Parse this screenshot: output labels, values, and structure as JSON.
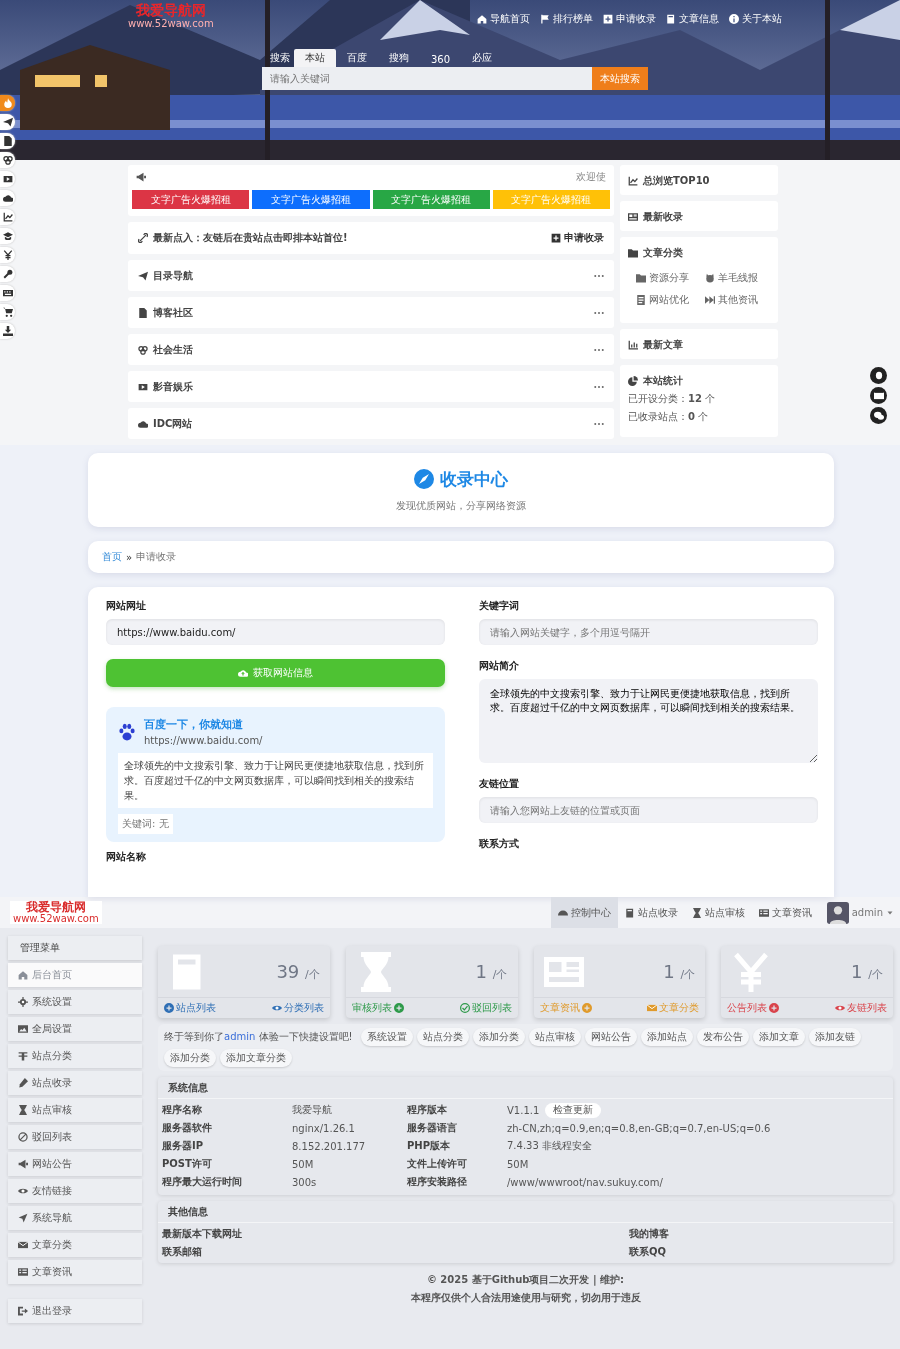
{
  "site": {
    "logo": "我爱导航网",
    "logo_url": "www.52waw.com",
    "nav": [
      "导航首页",
      "排行榜单",
      "申请收录",
      "文章信息",
      "关于本站"
    ],
    "search": {
      "label": "搜索",
      "tabs": [
        {
          "label": "本站",
          "selected": true
        },
        {
          "label": "百度",
          "selected": false
        },
        {
          "label": "搜狗",
          "selected": false
        },
        {
          "label": "360",
          "selected": false
        },
        {
          "label": "必应",
          "selected": false
        }
      ],
      "placeholder": "请输入关键词",
      "button": "本站搜索"
    },
    "notice": {
      "welcome": "欢迎使",
      "ads": [
        {
          "label": "文字广告火爆招租",
          "color": "#dc3545"
        },
        {
          "label": "文字广告火爆招租",
          "color": "#0d6efd"
        },
        {
          "label": "文字广告火爆招租",
          "color": "#28a745"
        },
        {
          "label": "文字广告火爆招租",
          "color": "#ffc107"
        }
      ],
      "tip": "最新点入：友链后在贵站点击即排本站首位!",
      "apply": "申请收录"
    },
    "categories": [
      "目录导航",
      "博客社区",
      "社会生活",
      "影音娱乐",
      "IDC网站"
    ],
    "widgets": {
      "top": "总浏览TOP10",
      "latest": "最新收录",
      "article_categories": {
        "title": "文章分类",
        "items": [
          "资源分享",
          "羊毛线报",
          "网站优化",
          "其他资讯"
        ]
      },
      "latest_articles": "最新文章",
      "stats": {
        "title": "本站统计",
        "rows": [
          {
            "label": "已开设分类：",
            "value": "12",
            "unit": "个"
          },
          {
            "label": "已收录站点：",
            "value": "0",
            "unit": "个"
          }
        ]
      }
    }
  },
  "submit_page": {
    "title": "收录中心",
    "subtitle": "发现优质网站，分享网络资源",
    "breadcrumb": {
      "home": "首页",
      "separator": "»",
      "current": "申请收录"
    },
    "url": {
      "label": "网站网址",
      "value": "https://www.baidu.com/"
    },
    "fetch_button": "获取网站信息",
    "preview": {
      "title": "百度一下，你就知道",
      "url": "https://www.baidu.com/",
      "description": "全球领先的中文搜索引擎、致力于让网民更便捷地获取信息，找到所求。百度超过千亿的中文网页数据库，可以瞬间找到相关的搜索结果。",
      "keywords": "关键词: 无"
    },
    "name_label": "网站名称",
    "keywords": {
      "label": "关键字词",
      "placeholder": "请输入网站关键字，多个用逗号隔开"
    },
    "intro": {
      "label": "网站简介",
      "value": "全球领先的中文搜索引擎、致力于让网民更便捷地获取信息，找到所求。百度超过千亿的中文网页数据库，可以瞬间找到相关的搜索结果。"
    },
    "link_position": {
      "label": "友链位置",
      "placeholder": "请输入您网站上友链的位置或页面"
    },
    "contact_label": "联系方式"
  },
  "admin": {
    "logo": "我爱导航网",
    "logo_url": "www.52waw.com",
    "nav": [
      {
        "label": "控制中心",
        "selected": true
      },
      {
        "label": "站点收录",
        "selected": false
      },
      {
        "label": "站点审核",
        "selected": false
      },
      {
        "label": "文章资讯",
        "selected": false
      }
    ],
    "user": "admin",
    "menu_title": "管理菜单",
    "menu": [
      {
        "label": "后台首页",
        "selected": true
      },
      {
        "label": "系统设置",
        "selected": false
      },
      {
        "label": "全局设置",
        "selected": false
      },
      {
        "label": "站点分类",
        "selected": false
      },
      {
        "label": "站点收录",
        "selected": false
      },
      {
        "label": "站点审核",
        "selected": false
      },
      {
        "label": "驳回列表",
        "selected": false
      },
      {
        "label": "网站公告",
        "selected": false
      },
      {
        "label": "友情链接",
        "selected": false
      },
      {
        "label": "系统导航",
        "selected": false
      },
      {
        "label": "文章分类",
        "selected": false
      },
      {
        "label": "文章资讯",
        "selected": false
      }
    ],
    "logout": "退出登录",
    "cards": [
      {
        "value": "39",
        "unit": "/个",
        "color": "#2f6fb5",
        "links": [
          "站点列表",
          "分类列表"
        ]
      },
      {
        "value": "1",
        "unit": "/个",
        "color": "#2e9a4a",
        "links": [
          "审核列表",
          "驳回列表"
        ]
      },
      {
        "value": "1",
        "unit": "/个",
        "color": "#e09a2b",
        "links": [
          "文章资讯",
          "文章分类"
        ]
      },
      {
        "value": "1",
        "unit": "/个",
        "color": "#d9434b",
        "links": [
          "公告列表",
          "友链列表"
        ]
      }
    ],
    "greeting": {
      "before": "终于等到你了",
      "user": "admin",
      "after": " 体验一下快捷设置吧!"
    },
    "quick": [
      "系统设置",
      "站点分类",
      "添加分类",
      "站点审核",
      "网站公告",
      "添加站点",
      "发布公告",
      "添加文章",
      "添加友链",
      "添加分类",
      "添加文章分类"
    ],
    "system_info": {
      "title": "系统信息",
      "update_button": "检查更新",
      "rows": [
        [
          "程序名称",
          "我爱导航",
          "程序版本",
          "V1.1.1"
        ],
        [
          "服务器软件",
          "nginx/1.26.1",
          "服务器语言",
          "zh-CN,zh;q=0.9,en;q=0.8,en-GB;q=0.7,en-US;q=0.6"
        ],
        [
          "服务器IP",
          "8.152.201.177",
          "PHP版本",
          "7.4.33 非线程安全"
        ],
        [
          "POST许可",
          "50M",
          "文件上传许可",
          "50M"
        ],
        [
          "程序最大运行时间",
          "300s",
          "程序安装路径",
          "/www/wwwroot/nav.sukuy.com/"
        ]
      ]
    },
    "other_info": {
      "title": "其他信息",
      "rows": [
        [
          "最新版本下载网址",
          "我的博客"
        ],
        [
          "联系邮箱",
          "联系QQ"
        ]
      ]
    },
    "footer": [
      "© 2025 基于Github项目二次开发 | 维护:",
      "本程序仅供个人合法用途使用与研究，切勿用于违反"
    ]
  }
}
